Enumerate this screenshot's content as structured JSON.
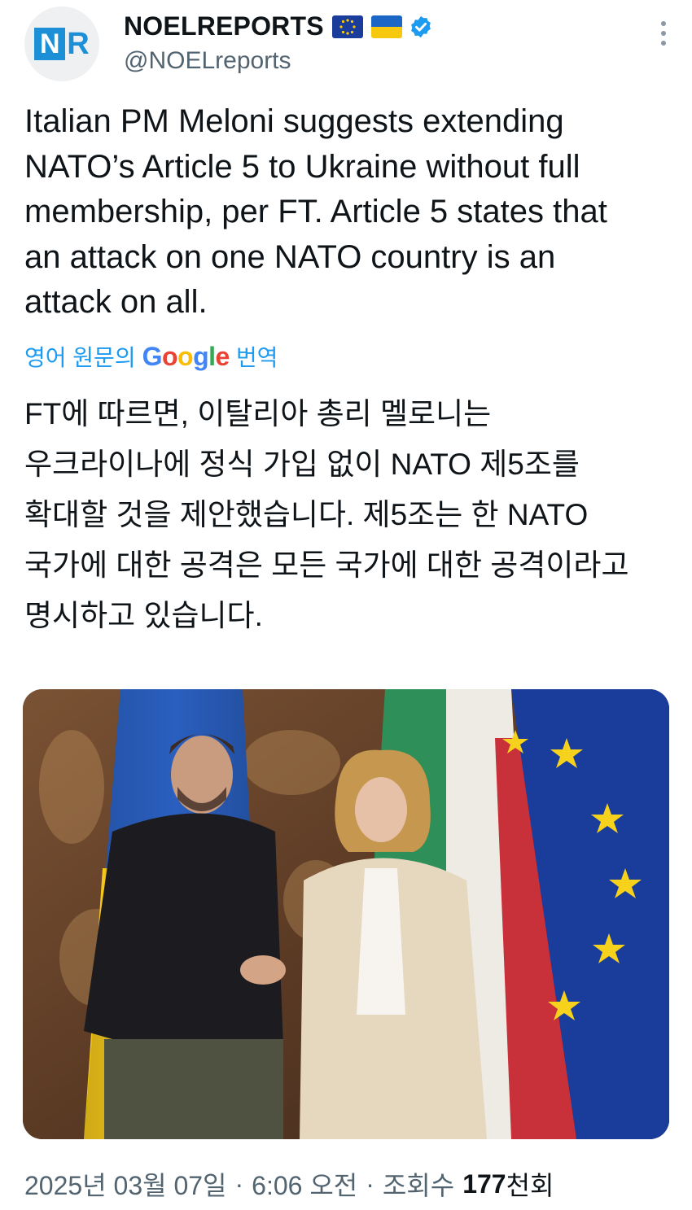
{
  "author": {
    "display_name": "NOELREPORTS",
    "handle": "@NOELreports",
    "logo_letter_1": "N",
    "logo_letter_2": "R",
    "badges": [
      "eu-flag-icon",
      "ukraine-flag-icon",
      "verified-badge-icon"
    ],
    "verified_color": "#1d9bf0"
  },
  "tweet": {
    "text": "Italian PM Meloni suggests extending\nNATO’s Article 5 to Ukraine without full\nmembership, per FT. Article 5 states that\nan attack on one NATO country is an\nattack on all.",
    "translate_prefix": "영어 원문의",
    "translate_brand": "Google",
    "translate_suffix": "번역",
    "translation": "FT에 따르면, 이탈리아 총리 멜로니는\n우크라이나에 정식 가입 없이 NATO 제5조를\n확대할 것을 제안했습니다. 제5조는 한 NATO\n국가에 대한 공격은 모든 국가에 대한 공격이라고\n명시하고 있습니다.",
    "media_alt": "photo"
  },
  "meta": {
    "date": "2025년 03월 07일",
    "separator": "·",
    "time": "6:06 오전",
    "views_label": "조회수",
    "views_count": "177",
    "views_unit": "천회"
  },
  "colors": {
    "link": "#1d9bf0",
    "secondary_text": "#536471",
    "logo_blue": "#1d8fd6"
  }
}
